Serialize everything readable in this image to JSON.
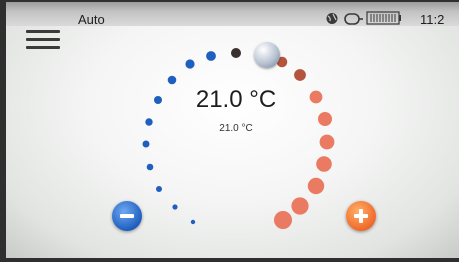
{
  "status_bar": {
    "mode_label": "Auto",
    "time": "11:2",
    "icons": [
      "globe-icon",
      "link-icon",
      "battery-icon"
    ]
  },
  "menu": {
    "icon": "hamburger-menu-icon"
  },
  "thermostat": {
    "setpoint_label": "21.0 °C",
    "current_label": "21.0 °C",
    "setpoint_fraction": 0.45,
    "cold_color": "#1f5fbf",
    "warm_color": "#f0692a"
  },
  "buttons": {
    "decrease_icon": "minus-icon",
    "increase_icon": "plus-icon"
  }
}
